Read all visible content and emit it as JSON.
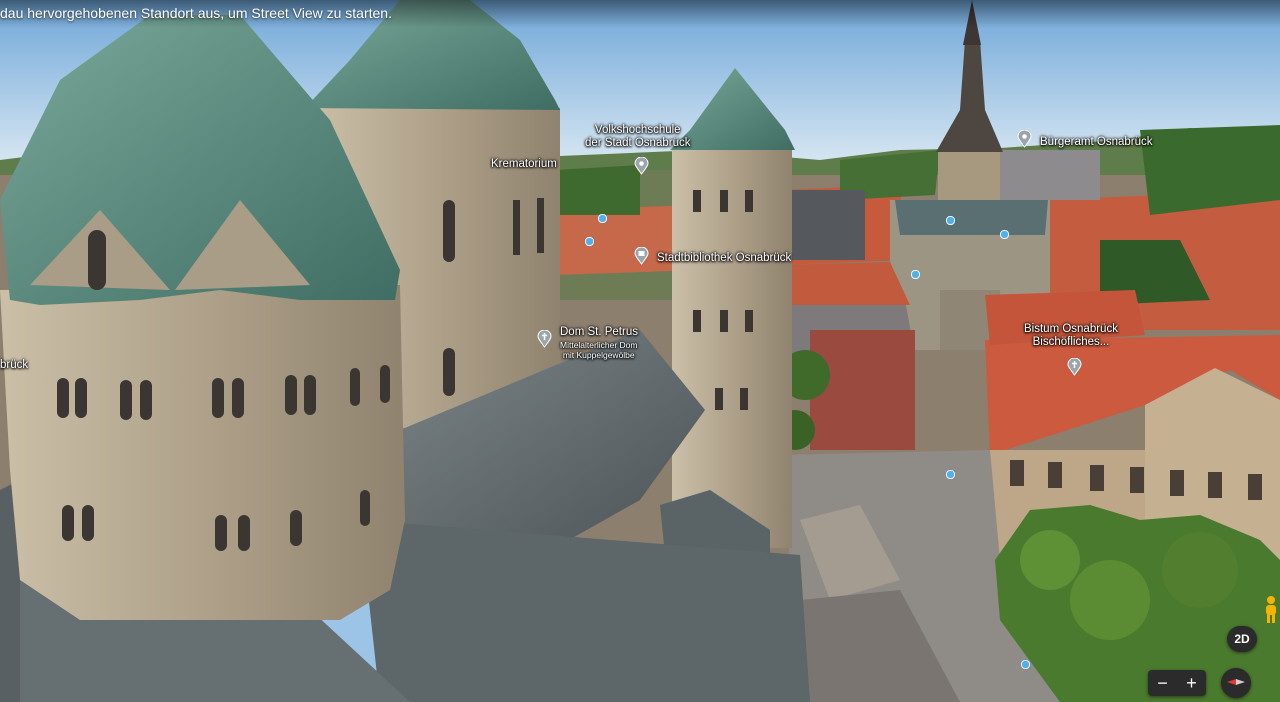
{
  "hint": {
    "text": "dau hervorgehobenen Standort aus, um Street View zu starten."
  },
  "labels": {
    "vhs": "Volkshochschule\nder Stadt Osnabrück",
    "krematorium": "Krematorium",
    "buergeramt": "Bürgeramt Osnabrück",
    "stadtbibliothek": "Stadtbibliothek Osnabrück",
    "dom_title": "Dom St. Petrus",
    "dom_sub": "Mittelalterlicher Dom\nmit Kuppelgewölbe",
    "bistum": "Bistum Osnabrück\nBischöfliches...",
    "left_cut": "brück"
  },
  "controls": {
    "view_2d": "2D",
    "zoom_out": "−",
    "zoom_in": "+"
  },
  "icons": [
    "place-pin-icon",
    "library-pin-icon",
    "church-pin-icon",
    "pegman-icon",
    "compass-icon",
    "zoom-out-icon",
    "zoom-in-icon"
  ],
  "colors": {
    "sky": "#9cc4e6",
    "roof_red": "#c65a3e",
    "copper_roof": "#5f8f80",
    "stone": "#b2a58e",
    "control_bg": "#2b2b2b",
    "pin_grey": "#9aa5ad"
  }
}
